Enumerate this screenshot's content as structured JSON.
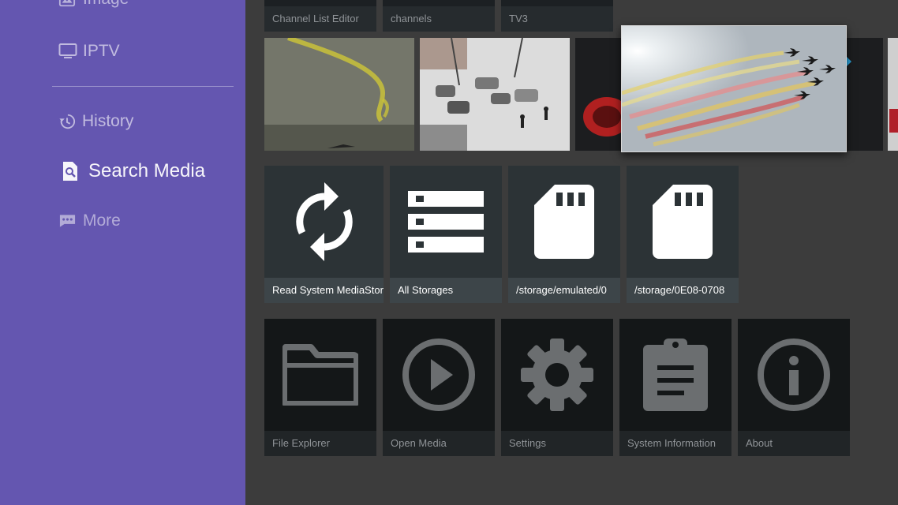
{
  "sidebar": {
    "items": [
      {
        "label": "Image",
        "icon": "image-icon"
      },
      {
        "label": "IPTV",
        "icon": "tv-icon"
      },
      {
        "label": "History",
        "icon": "history-icon"
      },
      {
        "label": "Search Media",
        "icon": "search-media-icon",
        "selected": true
      },
      {
        "label": "More",
        "icon": "more-icon"
      }
    ]
  },
  "top_row": [
    {
      "label": "Channel List Editor"
    },
    {
      "label": "channels"
    },
    {
      "label": "TV3"
    }
  ],
  "storage_row": [
    {
      "label": "Read System MediaStore",
      "icon": "refresh-icon"
    },
    {
      "label": "All Storages",
      "icon": "storage-list-icon"
    },
    {
      "label": "/storage/emulated/0",
      "icon": "sd-card-icon"
    },
    {
      "label": "/storage/0E08-0708",
      "icon": "sd-card-icon"
    }
  ],
  "tools_row": [
    {
      "label": "File Explorer",
      "icon": "folder-icon"
    },
    {
      "label": "Open Media",
      "icon": "play-circle-icon"
    },
    {
      "label": "Settings",
      "icon": "gear-icon"
    },
    {
      "label": "System Information",
      "icon": "clipboard-icon"
    },
    {
      "label": "About",
      "icon": "info-icon"
    }
  ],
  "colors": {
    "sidebar_bg": "#6456b0",
    "content_bg": "#3c3c3c",
    "tile_bg": "#141718",
    "highlight_tile_bg": "#2c3336"
  }
}
